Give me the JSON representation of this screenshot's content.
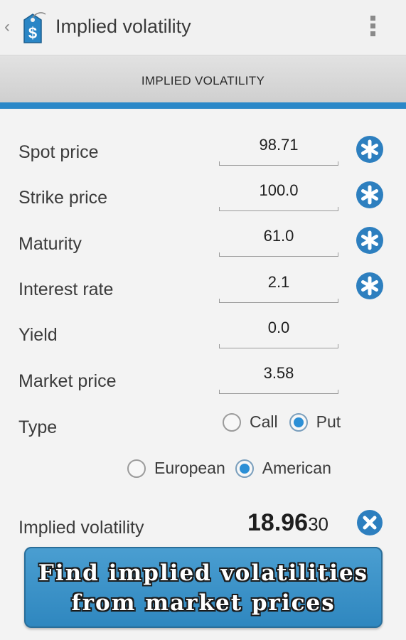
{
  "app": {
    "title": "Implied volatility",
    "up_caret": "‹"
  },
  "tab": {
    "label": "IMPLIED VOLATILITY"
  },
  "fields": [
    {
      "label": "Spot price",
      "value": "98.71"
    },
    {
      "label": "Strike price",
      "value": "100.0"
    },
    {
      "label": "Maturity",
      "value": "61.0"
    },
    {
      "label": "Interest rate",
      "value": "2.1"
    },
    {
      "label": "Yield",
      "value": "0.0"
    },
    {
      "label": "Market price",
      "value": "3.58"
    }
  ],
  "type": {
    "label": "Type",
    "option_call": "Call",
    "option_put": "Put",
    "option_european": "European",
    "option_american": "American",
    "selected_kind": "Put",
    "selected_style": "American"
  },
  "result": {
    "label": "Implied volatility",
    "value_main": "18.96",
    "value_tail": "30"
  },
  "banner": {
    "line1": "Find implied volatilities",
    "line2": "from market prices"
  },
  "colors": {
    "accent": "#2b88c8",
    "button_blue": "#2d7fbf",
    "banner_blue": "#3a93c9"
  },
  "icons": {
    "app": "price-tag-dollar-icon",
    "star_buttons": "asterisk-icon",
    "clear_result": "close-icon",
    "overflow": "overflow-menu-icon"
  }
}
